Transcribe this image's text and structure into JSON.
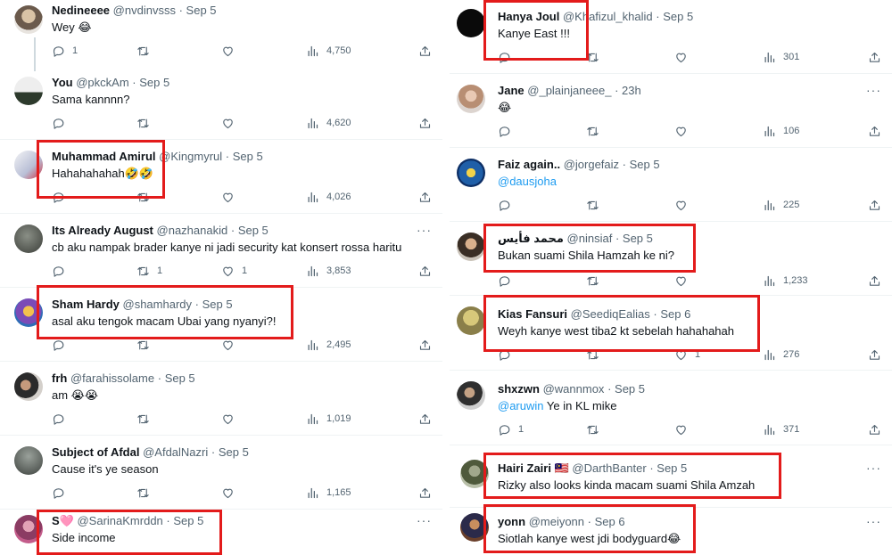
{
  "left_column": [
    {
      "name": "Nedineeee",
      "handle": "@nvdinvsss",
      "date": "Sep 5",
      "text": "Wey 😂",
      "reply_count": "1",
      "retweet_count": "",
      "like_count": "",
      "views": "4,750"
    },
    {
      "name": "You",
      "handle": "@pkckAm",
      "date": "Sep 5",
      "text": "Sama kannnn?",
      "reply_count": "",
      "retweet_count": "",
      "like_count": "",
      "views": "4,620"
    },
    {
      "name": "Muhammad Amirul",
      "handle": "@Kingmyrul",
      "date": "Sep 5",
      "text": "Hahahahahah🤣🤣",
      "reply_count": "",
      "retweet_count": "",
      "like_count": "",
      "views": "4,026"
    },
    {
      "name": "Its Already August",
      "handle": "@nazhanakid",
      "date": "Sep 5",
      "text": "cb aku nampak brader kanye ni jadi security kat konsert rossa haritu",
      "reply_count": "",
      "retweet_count": "1",
      "like_count": "1",
      "views": "3,853"
    },
    {
      "name": "Sham Hardy",
      "handle": "@shamhardy",
      "date": "Sep 5",
      "text": "asal aku tengok macam Ubai yang nyanyi?!",
      "reply_count": "",
      "retweet_count": "",
      "like_count": "",
      "views": "2,495"
    },
    {
      "name": "frh",
      "handle": "@farahissolame",
      "date": "Sep 5",
      "text": "am 😭😭",
      "reply_count": "",
      "retweet_count": "",
      "like_count": "",
      "views": "1,019"
    },
    {
      "name": "Subject of Afdal",
      "handle": "@AfdalNazri",
      "date": "Sep 5",
      "text": "Cause it's ye season",
      "reply_count": "",
      "retweet_count": "",
      "like_count": "",
      "views": "1,165"
    },
    {
      "name": "S🩷",
      "handle": "@SarinaKmrddn",
      "date": "Sep 5",
      "text": "Side income",
      "reply_count": "",
      "retweet_count": "",
      "like_count": "",
      "views": ""
    }
  ],
  "right_column": [
    {
      "name": "Hanya Joul",
      "handle": "@Khafizul_khalid",
      "date": "Sep 5",
      "text": "Kanye East !!!",
      "mention": "",
      "reply_count": "",
      "retweet_count": "",
      "like_count": "",
      "views": "301"
    },
    {
      "name": "Jane",
      "handle": "@_plainjaneee_",
      "date": "23h",
      "text": "😂",
      "mention": "",
      "reply_count": "",
      "retweet_count": "",
      "like_count": "",
      "views": "106"
    },
    {
      "name": "Faiz again..",
      "handle": "@jorgefaiz",
      "date": "Sep 5",
      "text": "",
      "mention": "@dausjoha",
      "reply_count": "",
      "retweet_count": "",
      "like_count": "",
      "views": "225"
    },
    {
      "name": "محمد فأيس",
      "handle": "@ninsiaf",
      "date": "Sep 5",
      "text": "Bukan suami Shila Hamzah ke ni?",
      "mention": "",
      "reply_count": "",
      "retweet_count": "",
      "like_count": "",
      "views": "1,233"
    },
    {
      "name": "Kias Fansuri",
      "handle": "@SeediqEalias",
      "date": "Sep 6",
      "text": "Weyh kanye west tiba2 kt sebelah hahahahah",
      "mention": "",
      "reply_count": "",
      "retweet_count": "",
      "like_count": "1",
      "views": "276"
    },
    {
      "name": "shxzwn",
      "handle": "@wannmox",
      "date": "Sep 5",
      "text": "Ye in KL mike",
      "mention": "@aruwin",
      "reply_count": "1",
      "retweet_count": "",
      "like_count": "",
      "views": "371"
    },
    {
      "name": "Hairi Zairi 🇲🇾",
      "handle": "@DarthBanter",
      "date": "Sep 5",
      "text": "Rizky also looks kinda macam suami Shila Amzah",
      "mention": "",
      "reply_count": "",
      "retweet_count": "",
      "like_count": "",
      "views": ""
    },
    {
      "name": "yonn",
      "handle": "@meiyonn",
      "date": "Sep 6",
      "text": "Siotlah kanye west jdi bodyguard😂",
      "mention": "",
      "reply_count": "",
      "retweet_count": "",
      "like_count": "",
      "views": ""
    }
  ],
  "ui": {
    "more_glyph": "···",
    "separator": "·",
    "accent": "#1d9bf0",
    "highlight": "#e31b1b"
  }
}
